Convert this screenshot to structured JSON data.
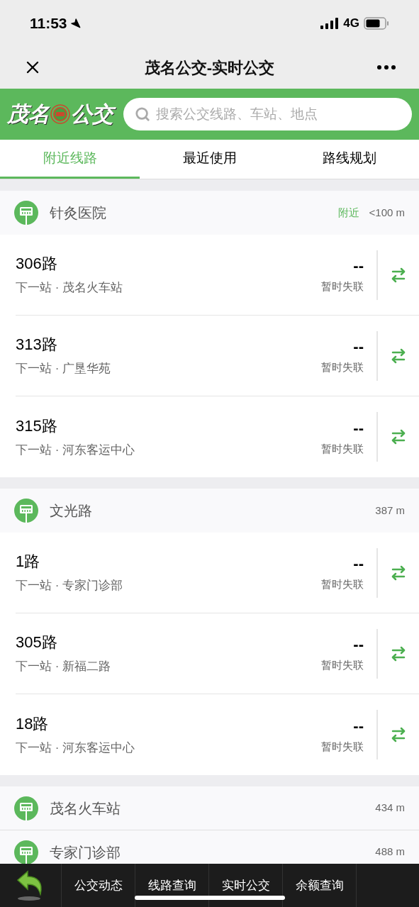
{
  "status_bar": {
    "time": "11:53",
    "network": "4G"
  },
  "nav": {
    "title": "茂名公交-实时公交"
  },
  "header": {
    "logo_left": "茂名",
    "logo_right": "公交",
    "search": {
      "placeholder": "搜索公交线路、车站、地点"
    }
  },
  "tabs": [
    {
      "label": "附近线路",
      "selected": true
    },
    {
      "label": "最近使用",
      "selected": false
    },
    {
      "label": "路线规划",
      "selected": false
    }
  ],
  "stops": [
    {
      "name": "针灸医院",
      "tag": "附近",
      "distance": "<100 m",
      "routes": [
        {
          "line": "306路",
          "next": "下一站 · 茂名火车站",
          "eta": "--",
          "status": "暂时失联"
        },
        {
          "line": "313路",
          "next": "下一站 · 广垦华苑",
          "eta": "--",
          "status": "暂时失联"
        },
        {
          "line": "315路",
          "next": "下一站 · 河东客运中心",
          "eta": "--",
          "status": "暂时失联"
        }
      ]
    },
    {
      "name": "文光路",
      "distance": "387 m",
      "routes": [
        {
          "line": "1路",
          "next": "下一站 · 专家门诊部",
          "eta": "--",
          "status": "暂时失联"
        },
        {
          "line": "305路",
          "next": "下一站 · 新福二路",
          "eta": "--",
          "status": "暂时失联"
        },
        {
          "line": "18路",
          "next": "下一站 · 河东客运中心",
          "eta": "--",
          "status": "暂时失联"
        }
      ]
    },
    {
      "name": "茂名火车站",
      "distance": "434 m"
    },
    {
      "name": "专家门诊部",
      "distance": "488 m"
    }
  ],
  "bottom_bar": {
    "items": [
      "公交动态",
      "线路查询",
      "实时公交",
      "余额查询"
    ]
  }
}
